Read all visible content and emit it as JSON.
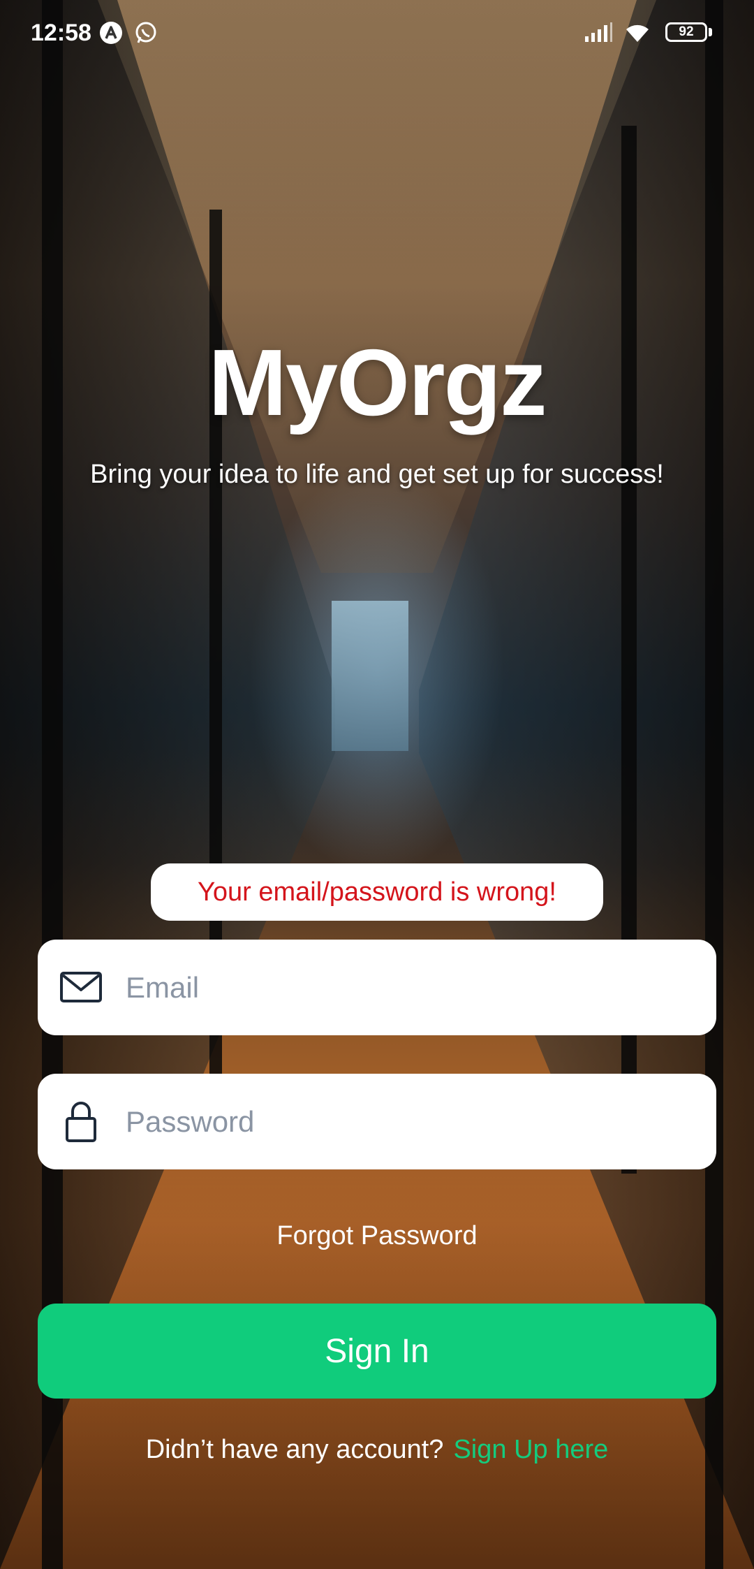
{
  "status_bar": {
    "time": "12:58",
    "battery": "92",
    "icons": [
      "app-a-icon",
      "whatsapp-icon",
      "signal-icon",
      "wifi-icon",
      "battery-icon"
    ]
  },
  "app": {
    "title": "MyOrgz",
    "tagline": "Bring your idea to life and get set up for success!"
  },
  "login": {
    "error": "Your email/password is wrong!",
    "email_placeholder": "Email",
    "password_placeholder": "Password",
    "forgot_label": "Forgot Password",
    "signin_label": "Sign In",
    "signup_prompt": "Didn’t have any account?",
    "signup_link": "Sign Up here"
  },
  "colors": {
    "accent": "#10cc7c",
    "error": "#d4141b",
    "link": "#14cc7e"
  }
}
